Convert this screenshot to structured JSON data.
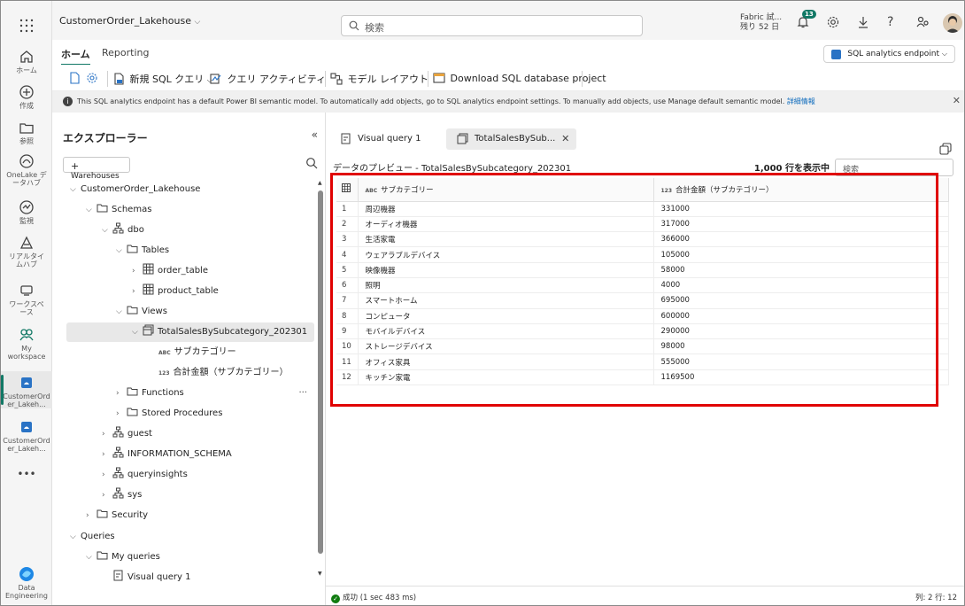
{
  "topbar": {
    "workspace": "CustomerOrder_Lakehouse",
    "search_placeholder": "検索",
    "trial_line1": "Fabric 試...",
    "trial_line2": "残り 52 日",
    "notifications": "13"
  },
  "rail": [
    {
      "label": "ホーム",
      "icon": "home-icon"
    },
    {
      "label": "作成",
      "icon": "create-icon"
    },
    {
      "label": "参照",
      "icon": "browse-icon"
    },
    {
      "label": "OneLake データハブ",
      "icon": "onelake-icon"
    },
    {
      "label": "監視",
      "icon": "monitor-icon"
    },
    {
      "label": "リアルタイムハブ",
      "icon": "realtime-icon"
    },
    {
      "label": "ワークスペース",
      "icon": "workspaces-icon"
    },
    {
      "label": "My workspace",
      "icon": "my-workspace-icon"
    },
    {
      "label": "CustomerOrder_Lakeh...",
      "icon": "lakehouse-icon"
    },
    {
      "label": "CustomerOrder_Lakeh...",
      "icon": "lakehouse-icon"
    },
    {
      "label": "Data Engineering",
      "icon": "data-engineering-icon"
    }
  ],
  "ribbon": {
    "tabs": [
      "ホーム",
      "Reporting"
    ],
    "endpoint": "SQL analytics endpoint",
    "tools": {
      "new_sql": "新規 SQL クエリ",
      "query_activity": "クエリ アクティビティ",
      "model_layout": "モデル レイアウト",
      "download": "Download SQL database project"
    }
  },
  "infobar": {
    "text": "This SQL analytics endpoint has a default Power BI semantic model. To automatically add objects, go to SQL analytics endpoint settings. To manually add objects, use Manage default semantic model.",
    "link": "詳細情報"
  },
  "explorer": {
    "title": "エクスプローラー",
    "warehouses_btn": "Warehouses",
    "tree": {
      "lakehouse": "CustomerOrder_Lakehouse",
      "schemas": "Schemas",
      "dbo": "dbo",
      "tables": "Tables",
      "order_table": "order_table",
      "product_table": "product_table",
      "views": "Views",
      "view_name": "TotalSalesBySubcategory_202301",
      "col1": "サブカテゴリー",
      "col2": "合計金額（サブカテゴリー）",
      "functions": "Functions",
      "stored_procedures": "Stored Procedures",
      "guest": "guest",
      "info_schema": "INFORMATION_SCHEMA",
      "queryinsights": "queryinsights",
      "sys": "sys",
      "security": "Security",
      "queries": "Queries",
      "my_queries": "My queries",
      "visual_query": "Visual query 1"
    }
  },
  "main": {
    "tabs": [
      "Visual query 1",
      "TotalSalesBySub..."
    ],
    "preview_title": "データのプレビュー - TotalSalesBySubcategory_202301",
    "row_count": "1,000 行を表示中",
    "search_placeholder": "検索",
    "columns": [
      "サブカテゴリー",
      "合計金額（サブカテゴリー）"
    ],
    "rows": [
      [
        "1",
        "周辺機器",
        "331000"
      ],
      [
        "2",
        "オーディオ機器",
        "317000"
      ],
      [
        "3",
        "生活家電",
        "366000"
      ],
      [
        "4",
        "ウェアラブルデバイス",
        "105000"
      ],
      [
        "5",
        "映像機器",
        "58000"
      ],
      [
        "6",
        "照明",
        "4000"
      ],
      [
        "7",
        "スマートホーム",
        "695000"
      ],
      [
        "8",
        "コンピュータ",
        "600000"
      ],
      [
        "9",
        "モバイルデバイス",
        "290000"
      ],
      [
        "10",
        "ストレージデバイス",
        "98000"
      ],
      [
        "11",
        "オフィス家具",
        "555000"
      ],
      [
        "12",
        "キッチン家電",
        "1169500"
      ]
    ],
    "status": "成功 (1 sec 483 ms)",
    "position": "列: 2 行: 12"
  }
}
